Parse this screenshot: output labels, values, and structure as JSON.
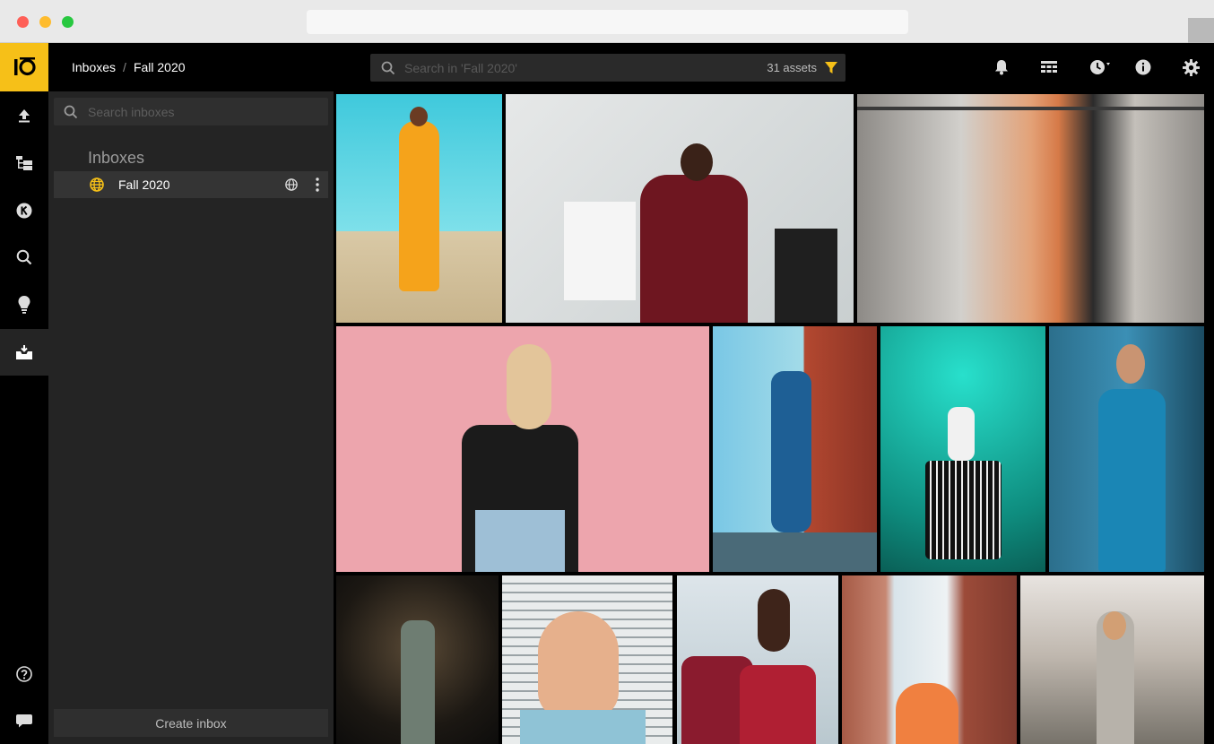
{
  "app": {
    "logo_text": "IO",
    "breadcrumb": {
      "root": "Inboxes",
      "separator": "/",
      "current": "Fall 2020"
    },
    "search": {
      "placeholder": "Search in 'Fall 2020'",
      "asset_count": "31 assets"
    },
    "toolbar_icons": [
      "bell-icon",
      "grid-view-icon",
      "history-icon",
      "info-icon",
      "gear-icon"
    ]
  },
  "rail": {
    "items": [
      "upload-icon",
      "folder-tree-icon",
      "keyword-icon",
      "search-icon",
      "lightbulb-icon",
      "inbox-icon"
    ],
    "active": "inbox-icon",
    "bottom": [
      "help-icon",
      "chat-icon"
    ]
  },
  "panel": {
    "search_placeholder": "Search inboxes",
    "title": "Inboxes",
    "items": [
      {
        "label": "Fall 2020"
      }
    ],
    "create_label": "Create inbox"
  },
  "colors": {
    "accent": "#f6c018",
    "panel": "#242424",
    "selected": "#343434"
  },
  "gallery": {
    "tiles": [
      {
        "name": "photo-yellow-tracksuit"
      },
      {
        "name": "photo-shopping-bags"
      },
      {
        "name": "photo-clothing-rack"
      },
      {
        "name": "photo-pink-wall"
      },
      {
        "name": "photo-city-street-man"
      },
      {
        "name": "photo-neon-teal"
      },
      {
        "name": "photo-blue-jumpsuit"
      },
      {
        "name": "photo-tunnel-night"
      },
      {
        "name": "photo-blinds-portrait"
      },
      {
        "name": "photo-two-women-red"
      },
      {
        "name": "photo-orange-dress-city"
      },
      {
        "name": "photo-park-dress"
      }
    ]
  }
}
